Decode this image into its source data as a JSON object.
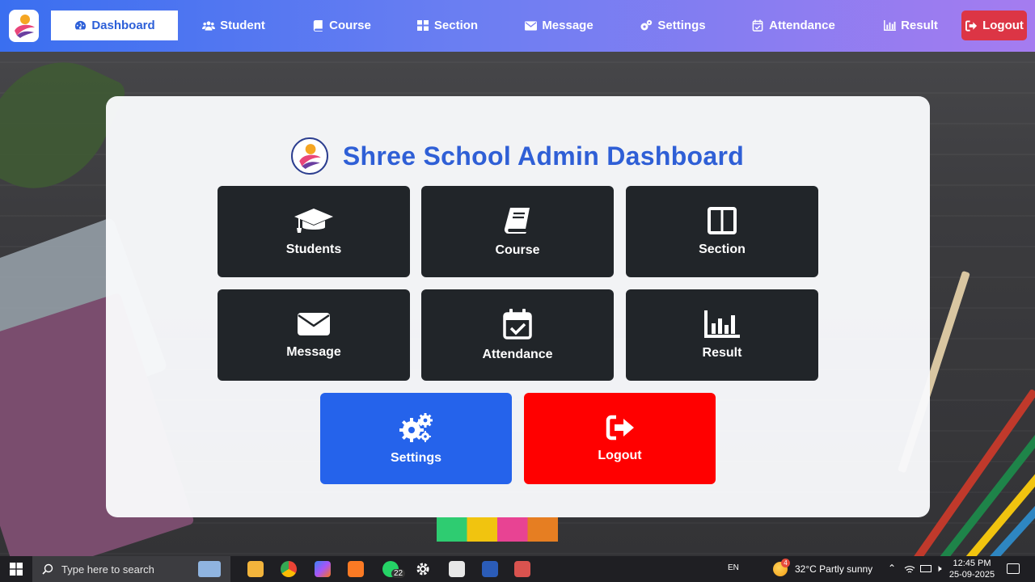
{
  "nav": {
    "items": [
      {
        "label": "Dashboard",
        "icon": "dashboard-icon",
        "active": true
      },
      {
        "label": "Student",
        "icon": "users-icon"
      },
      {
        "label": "Course",
        "icon": "book-icon"
      },
      {
        "label": "Section",
        "icon": "grid-icon"
      },
      {
        "label": "Message",
        "icon": "envelope-icon"
      },
      {
        "label": "Settings",
        "icon": "gears-icon"
      },
      {
        "label": "Attendance",
        "icon": "calendar-check-icon"
      },
      {
        "label": "Result",
        "icon": "bar-chart-icon"
      }
    ],
    "logout_label": "Logout"
  },
  "main": {
    "title": "Shree School Admin Dashboard",
    "tiles": [
      {
        "label": "Students",
        "icon": "graduation-cap-icon"
      },
      {
        "label": "Course",
        "icon": "book-icon"
      },
      {
        "label": "Section",
        "icon": "columns-icon"
      },
      {
        "label": "Message",
        "icon": "envelope-icon"
      },
      {
        "label": "Attendance",
        "icon": "calendar-check-icon"
      },
      {
        "label": "Result",
        "icon": "bar-chart-icon"
      },
      {
        "label": "Settings",
        "icon": "gears-icon"
      },
      {
        "label": "Logout",
        "icon": "sign-out-icon"
      }
    ]
  },
  "colors": {
    "navbar_start": "#3a6ff0",
    "navbar_end": "#a57cf0",
    "title": "#2f5fd6",
    "tile_dark": "#212529",
    "tile_blue": "#2563eb",
    "tile_red": "#ff0000",
    "logout_nav": "#dc3545"
  },
  "taskbar": {
    "search_placeholder": "Type here to search",
    "whatsapp_badge": "22",
    "language": "EN",
    "weather": "32°C  Partly sunny",
    "weather_badge": "4",
    "time": "12:45 PM",
    "date": "25-09-2025"
  }
}
